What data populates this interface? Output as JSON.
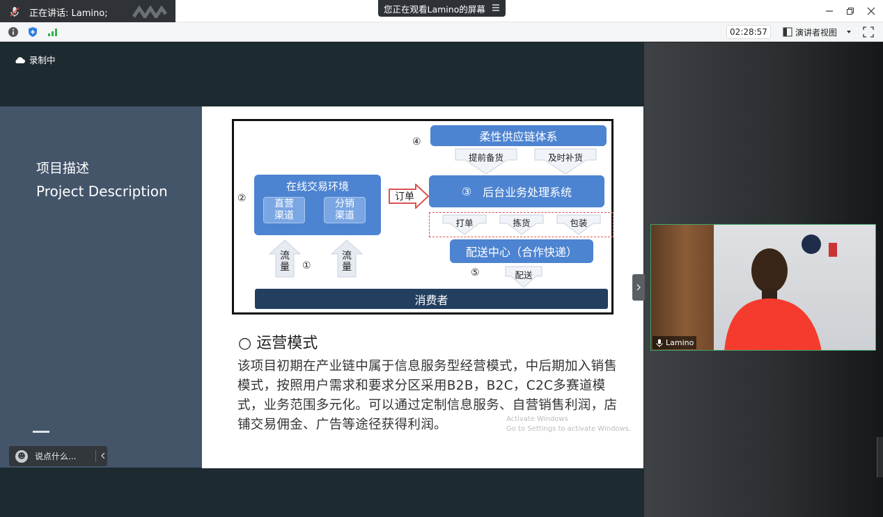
{
  "titlebar": {
    "speaking_label": "正在讲话: Lamino;",
    "share_banner": "您正在观看Lamino的屏幕"
  },
  "toolbar": {
    "timer": "02:28:57",
    "presenter_view": "演讲者视图"
  },
  "recording": {
    "label": "录制中"
  },
  "slide": {
    "left_title_cn": "项目描述",
    "left_title_en": "Project Description",
    "diagram": {
      "circle_1": "①",
      "circle_2": "②",
      "circle_3": "③",
      "circle_4": "④",
      "circle_5": "⑤",
      "supply_chain": "柔性供应链体系",
      "prep_stock": "提前备货",
      "restock": "及时补货",
      "online_env": "在线交易环境",
      "direct_channel": "直营\n渠道",
      "dist_channel": "分销\n渠道",
      "order": "订单",
      "backend": "后台业务处理系统",
      "print": "打单",
      "pick": "拣货",
      "pack": "包装",
      "delivery_center": "配送中心（合作快递）",
      "traffic_1": "流\n量",
      "traffic_2": "流\n量",
      "delivery": "配送",
      "consumer": "消费者"
    },
    "ops_title": "○ 运营模式",
    "ops_body": "该项目初期在产业链中属于信息服务型经营模式，中后期加入销售模式，按照用户需求和要求分区采用B2B，B2C，C2C多赛道模式，业务范围多元化。可以通过定制信息服务、自营销售利润，店铺交易佣金、广告等途径获得利润。",
    "watermark_1": "Activate Windows",
    "watermark_2": "Go to Settings to activate Windows."
  },
  "chat": {
    "placeholder": "说点什么..."
  },
  "video": {
    "name": "Lamino"
  },
  "colors": {
    "accent_blue": "#4d84d1",
    "dark_navy": "#223f60",
    "slide_left_bg": "#44556a"
  }
}
